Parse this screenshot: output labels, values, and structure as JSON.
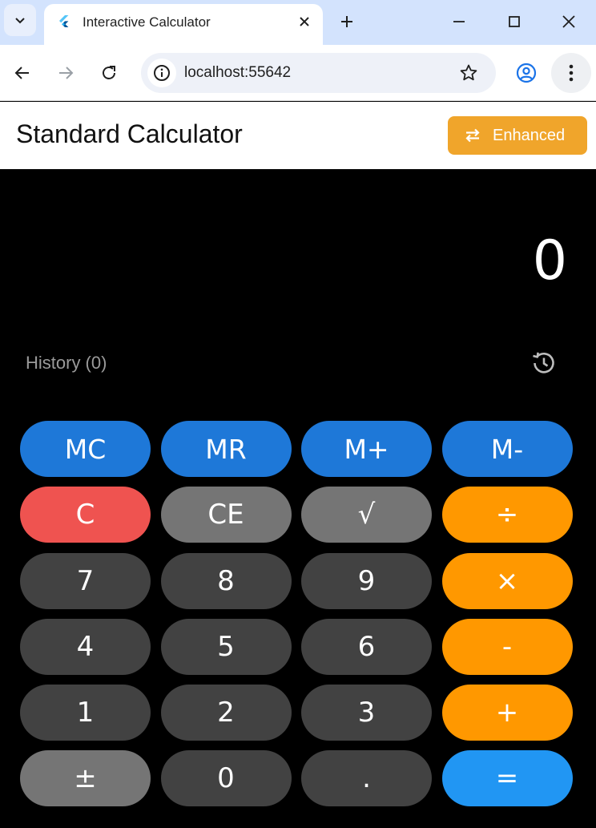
{
  "browser": {
    "tab_title": "Interactive Calculator",
    "url": "localhost:55642"
  },
  "app": {
    "title": "Standard Calculator",
    "mode_button_label": "Enhanced"
  },
  "display": {
    "value": "0"
  },
  "history": {
    "label": "History (0)"
  },
  "keypad": {
    "rows": [
      [
        "MC",
        "MR",
        "M+",
        "M-"
      ],
      [
        "C",
        "CE",
        "√",
        "÷"
      ],
      [
        "7",
        "8",
        "9",
        "×"
      ],
      [
        "4",
        "5",
        "6",
        "-"
      ],
      [
        "1",
        "2",
        "3",
        "+"
      ],
      [
        "±",
        "0",
        ".",
        "="
      ]
    ]
  },
  "colors": {
    "memory": "#1e78d8",
    "clear": "#ef5350",
    "function": "#757575",
    "operator": "#ff9800",
    "number": "#424242",
    "equals": "#2196f3",
    "mode_button": "#f0a52b"
  },
  "icons": {
    "tab_search": "chevron-down-icon",
    "favicon": "flutter-logo-icon",
    "tab_close": "close-icon",
    "new_tab": "plus-icon",
    "minimize": "minimize-icon",
    "maximize": "maximize-icon",
    "close_window": "close-icon",
    "back": "arrow-left-icon",
    "forward": "arrow-right-icon",
    "reload": "reload-icon",
    "site_info": "site-info-icon",
    "bookmark": "star-icon",
    "profile": "profile-icon",
    "menu": "kebab-menu-icon",
    "mode_switch": "swap-arrows-icon",
    "history": "history-icon"
  }
}
